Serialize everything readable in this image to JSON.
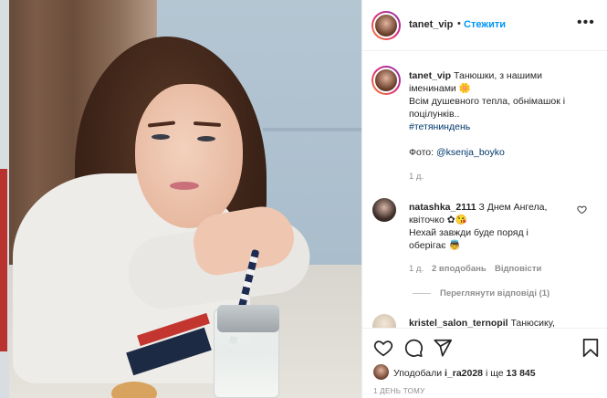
{
  "post": {
    "username": "tanet_vip",
    "separator": "•",
    "follow_label": "Стежити",
    "more_label": "•••"
  },
  "caption": {
    "username": "tanet_vip",
    "line1": "Танюшки, з нашими",
    "line2": "іменинами 🌼",
    "line3": "Всім душевного тепла, обнімашок і",
    "line4": "поцілунків..",
    "hashtag": "#тетяниндень",
    "photo_prefix": "Фото: ",
    "photo_credit": "@ksenja_boyko",
    "age": "1 д."
  },
  "comments": [
    {
      "username": "natashka_2111",
      "line1": "З Днем Ангела,",
      "line2": "квіточко ✿😘",
      "line3": "Нехай завжди буде поряд і",
      "line4": "оберігає 👼",
      "age": "1 д.",
      "likes": "2 вподобань",
      "reply_label": "Відповісти",
      "view_replies": "Переглянути відповіді (1)"
    },
    {
      "username": "kristel_salon_ternopil",
      "text": "Танюсику,"
    }
  ],
  "actions": {
    "liked_by_prefix": "Уподобали ",
    "liked_by_user": "i_ra2028",
    "liked_by_suffix": " і ще ",
    "liked_by_count": "13 845",
    "time": "1 ДЕНЬ ТОМУ"
  },
  "colors": {
    "link": "#0095f6",
    "hashtag": "#00376b",
    "muted": "#8e8e8e",
    "text": "#262626"
  },
  "icons": [
    "more-icon",
    "heart-icon",
    "comment-icon",
    "share-icon",
    "bookmark-icon"
  ]
}
